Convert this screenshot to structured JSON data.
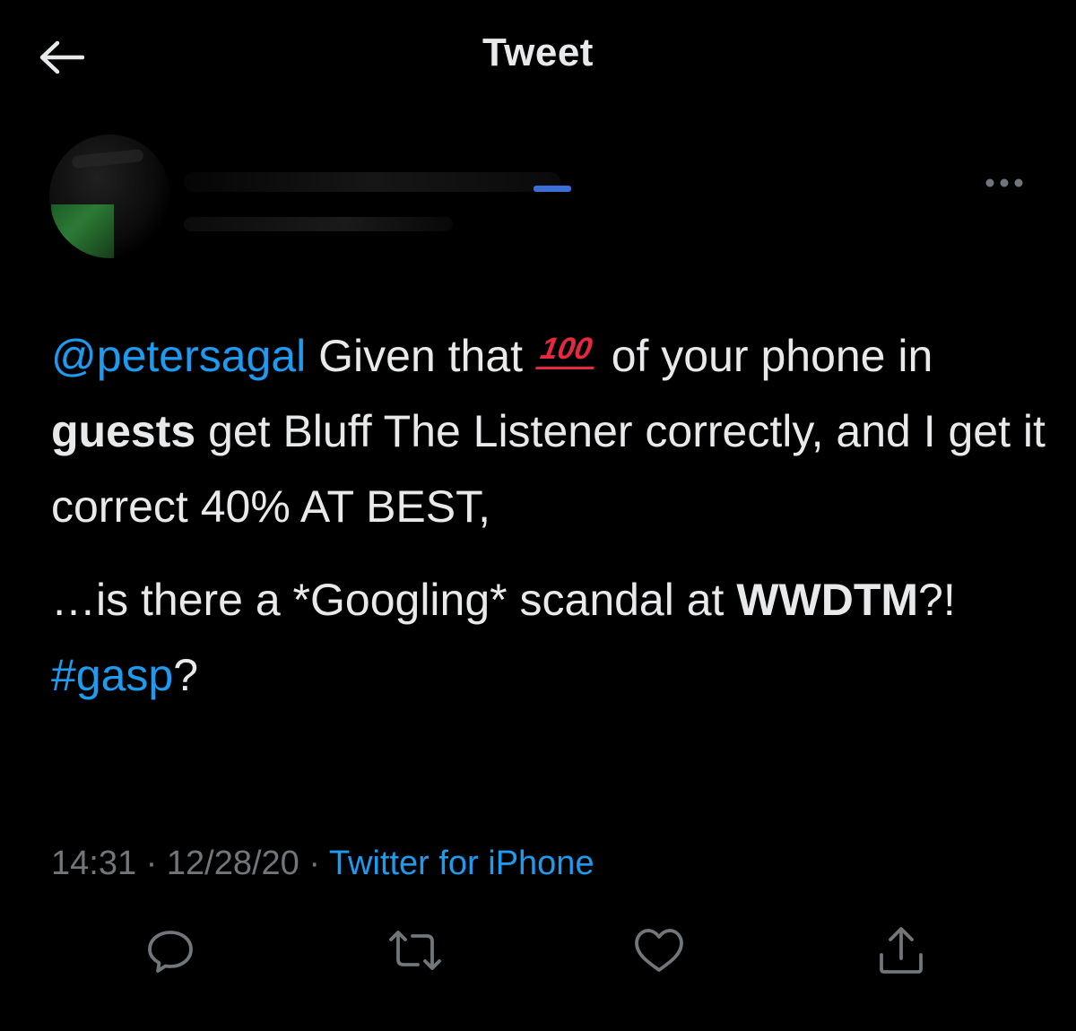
{
  "header": {
    "title": "Tweet",
    "back_icon": "arrow-left-icon"
  },
  "author": {
    "avatar_icon": "avatar",
    "redacted": true
  },
  "tweet": {
    "mention": "@petersagal",
    "segments": {
      "s1": " Given that ",
      "emoji": "100",
      "s2": "of your phone in ",
      "guests": "guests",
      "s3": " get Bluff The Listener correctly, and I get it correct 40% AT BEST,",
      "s4": "…is there a *Googling* scandal at ",
      "wwdtm": "WWDTM",
      "s5": "?!",
      "hashtag": "#gasp",
      "s6": "?"
    }
  },
  "meta": {
    "time": "14:31",
    "sep1": " · ",
    "date": "12/28/20",
    "sep2": " · ",
    "source": "Twitter for iPhone"
  },
  "actions": {
    "reply_icon": "reply-icon",
    "retweet_icon": "retweet-icon",
    "like_icon": "heart-icon",
    "share_icon": "share-icon"
  },
  "colors": {
    "background": "#000000",
    "text": "#e7e9ea",
    "link": "#1d9bf0",
    "muted": "#71767b"
  }
}
